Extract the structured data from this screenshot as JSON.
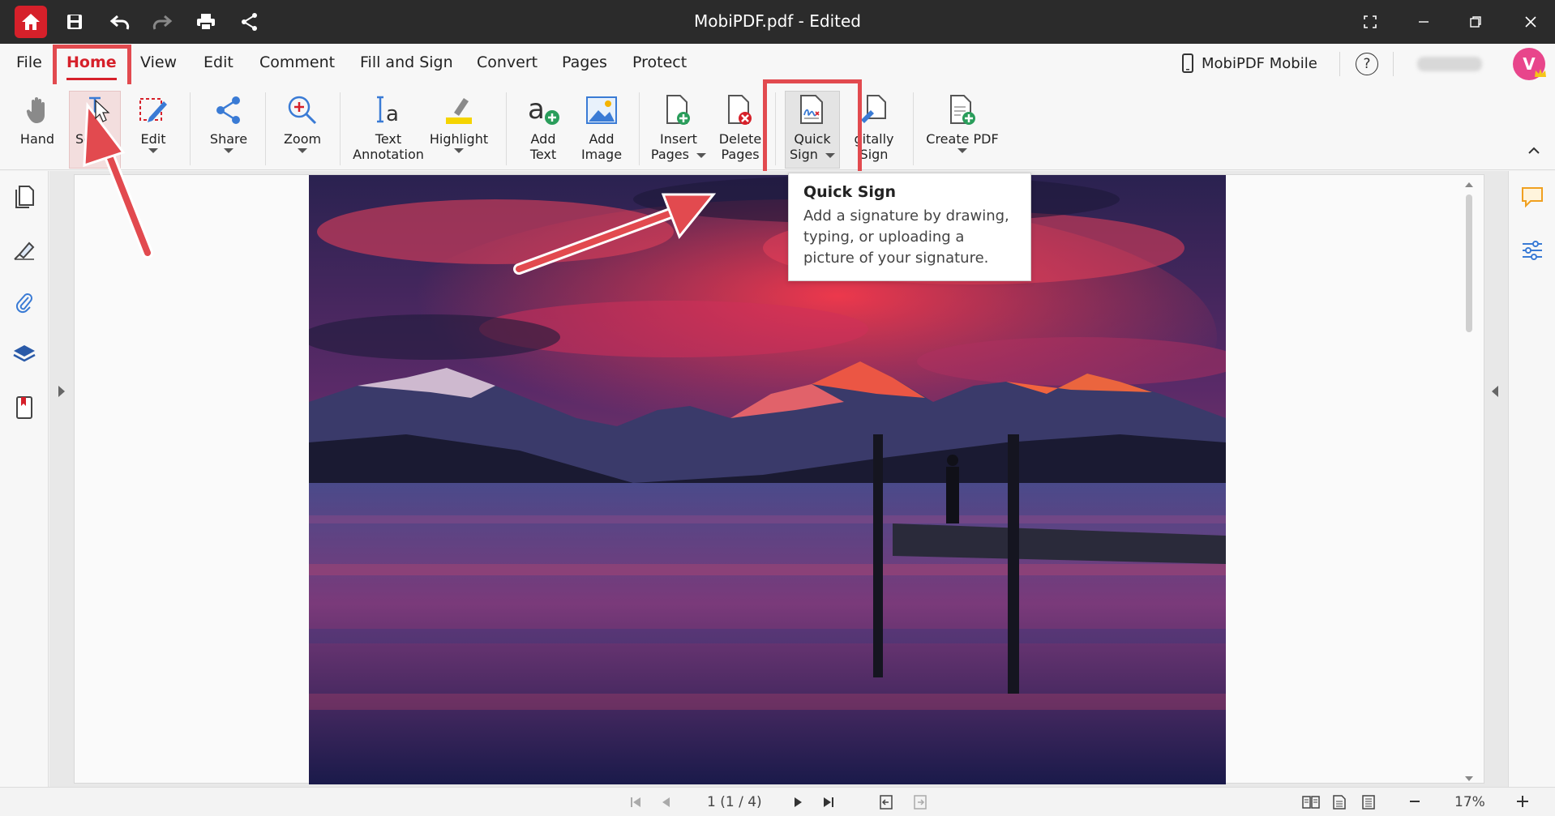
{
  "window": {
    "title": "MobiPDF.pdf - Edited"
  },
  "menu": {
    "items": [
      "File",
      "Home",
      "View",
      "Edit",
      "Comment",
      "Fill and Sign",
      "Convert",
      "Pages",
      "Protect"
    ],
    "mobile_label": "MobiPDF Mobile",
    "help": "?",
    "avatar": "V"
  },
  "ribbon": {
    "hand": "Hand",
    "select": "Se",
    "edit": "Edit",
    "share": "Share",
    "zoom": "Zoom",
    "text_annotation_1": "Text",
    "text_annotation_2": "Annotation",
    "highlight": "Highlight",
    "add_text_1": "Add",
    "add_text_2": "Text",
    "add_image_1": "Add",
    "add_image_2": "Image",
    "insert_pages_1": "Insert",
    "insert_pages_2": "Pages",
    "delete_pages_1": "Delete",
    "delete_pages_2": "Pages",
    "quick_sign_1": "Quick",
    "quick_sign_2": "Sign",
    "digitally_sign_1": "gitally",
    "digitally_sign_2": "Sign",
    "create_pdf": "Create PDF"
  },
  "tooltip": {
    "title": "Quick Sign",
    "description": "Add a signature by drawing, typing, or uploading a picture of your signature."
  },
  "status": {
    "page": "1 (1 / 4)",
    "zoom": "17%"
  },
  "colors": {
    "brand": "#d6202a",
    "highlight_box": "#e24a4f",
    "titlebar": "#2b2b2b"
  }
}
